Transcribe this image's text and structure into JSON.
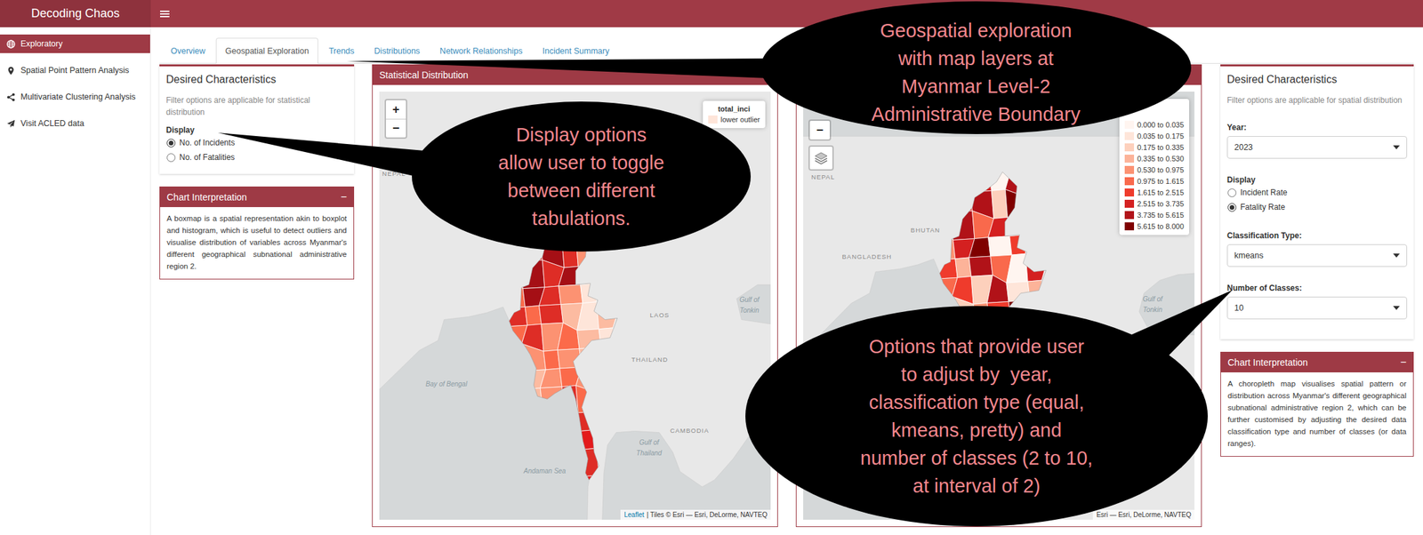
{
  "header": {
    "brand": "Decoding Chaos"
  },
  "sidebar": {
    "items": [
      {
        "label": "Exploratory",
        "selected": true
      },
      {
        "label": "Spatial Point Pattern Analysis",
        "selected": false
      },
      {
        "label": "Multivariate Clustering Analysis",
        "selected": false
      },
      {
        "label": "Visit ACLED data",
        "selected": false
      }
    ]
  },
  "tabs": [
    {
      "label": "Overview",
      "selected": false
    },
    {
      "label": "Geospatial Exploration",
      "selected": true
    },
    {
      "label": "Trends",
      "selected": false
    },
    {
      "label": "Distributions",
      "selected": false
    },
    {
      "label": "Network Relationships",
      "selected": false
    },
    {
      "label": "Incident Summary",
      "selected": false
    }
  ],
  "left_panel": {
    "title": "Desired Characteristics",
    "note": "Filter options are applicable for statistical distribution",
    "fields": [
      {
        "kind": "radio",
        "label": "Display",
        "options": [
          {
            "label": "No. of Incidents",
            "selected": true
          },
          {
            "label": "No. of Fatalities",
            "selected": false
          }
        ]
      }
    ]
  },
  "left_interpretation": {
    "title": "Chart Interpretation",
    "toggle": "−",
    "text": "A boxmap is a spatial representation akin to boxplot and histogram, which is useful to detect outliers and visualise distribution of variables across Myanmar's different geographical subnational administrative region 2."
  },
  "maps": [
    {
      "title": "Statistical Distribution",
      "zoom": [
        "+",
        "−"
      ],
      "layers": false,
      "legend": {
        "title": "total_inci",
        "items": [
          {
            "label": "lower outlier",
            "color": "#fee5d9"
          }
        ]
      },
      "labels": [
        {
          "text": "NEPAL",
          "kind": "country"
        },
        {
          "text": "LAOS",
          "kind": "country"
        },
        {
          "text": "Gulf of",
          "kind": "water"
        },
        {
          "text": "Tonkin",
          "kind": "water"
        },
        {
          "text": "THAILAND",
          "kind": "country"
        },
        {
          "text": "Bay of Bengal",
          "kind": "water"
        },
        {
          "text": "CAMBODIA",
          "kind": "country"
        },
        {
          "text": "Gulf of",
          "kind": "water"
        },
        {
          "text": "Thailand",
          "kind": "water"
        },
        {
          "text": "Andaman Sea",
          "kind": "water"
        }
      ],
      "attribution_link": "Leaflet",
      "attribution": "| Tiles © Esri — Esri, DeLorme, NAVTEQ",
      "regions": [
        [
          "#a50f15",
          "#de2d26",
          "#fb6a4a"
        ],
        [
          "#de2d26",
          "#a50f15",
          "#de2d26",
          "#fc9272"
        ],
        [
          "#a50f15",
          "#de2d26",
          "#a50f15",
          "#fcbba1"
        ],
        [
          "#fb6a4a",
          "#a50f15",
          "#de2d26",
          "#fc9272",
          "#fee5d9"
        ],
        [
          "#de2d26",
          "#fb6a4a",
          "#de2d26",
          "#fcbba1",
          "#fee5d9",
          "#fcbba1"
        ],
        [
          "#fb6a4a",
          "#de2d26",
          "#fc9272",
          "#fb6a4a",
          "#fcbba1",
          "#fee5d9"
        ],
        [
          "#fc9272",
          "#fb6a4a",
          "#fc9272",
          "#fcbba1"
        ],
        [
          "#fcbba1",
          "#fc9272",
          "#fb6a4a",
          "#fc9272"
        ],
        [
          "#fcbba1",
          "#fc9272",
          "#de2d26",
          "#fb6a4a"
        ],
        [
          "#de2d26"
        ],
        [
          "#e31a1c"
        ],
        [
          "#de2d26"
        ],
        [
          "#e31a1c"
        ]
      ]
    },
    {
      "zoom": [
        "−"
      ],
      "layers": true,
      "legend": {
        "items": [
          {
            "label": "0.000 to 0.035",
            "color": "#fff5f0"
          },
          {
            "label": "0.035 to 0.175",
            "color": "#fee5d9"
          },
          {
            "label": "0.175 to 0.335",
            "color": "#fdd0bc"
          },
          {
            "label": "0.335 to 0.530",
            "color": "#fcb399"
          },
          {
            "label": "0.530 to 0.975",
            "color": "#fc9272"
          },
          {
            "label": "0.975 to 1.615",
            "color": "#f9694c"
          },
          {
            "label": "1.615 to 2.515",
            "color": "#ef3b2c"
          },
          {
            "label": "2.515 to 3.735",
            "color": "#d42020"
          },
          {
            "label": "3.735 to 5.615",
            "color": "#b11218"
          },
          {
            "label": "5.615 to 8.000",
            "color": "#7f0000"
          }
        ]
      },
      "labels": [
        {
          "text": "NEPAL",
          "kind": "country"
        },
        {
          "text": "BHUTAN",
          "kind": "country"
        },
        {
          "text": "BANGLADESH",
          "kind": "country"
        },
        {
          "text": "Gulf of",
          "kind": "water"
        },
        {
          "text": "Tonkin",
          "kind": "water"
        }
      ],
      "attribution": "Esri — Esri, DeLorme, NAVTEQ",
      "regions": [
        [
          "#d42020",
          "#fff5f0",
          "#b11218"
        ],
        [
          "#ef3b2c",
          "#b11218",
          "#fdd0bc",
          "#7f0000"
        ],
        [
          "#b11218",
          "#f9694c",
          "#d42020",
          "#fee5d9"
        ],
        [
          "#fc9272",
          "#d42020",
          "#7f0000",
          "#fff5f0",
          "#ef3b2c"
        ],
        [
          "#ef3b2c",
          "#fcb399",
          "#b11218",
          "#f9694c",
          "#fff5f0",
          "#d42020"
        ],
        [
          "#f9694c",
          "#ef3b2c",
          "#fdd0bc",
          "#b11218",
          "#fee5d9",
          "#fcb399"
        ],
        [
          "#fdd0bc",
          "#fc9272",
          "#ef3b2c",
          "#7f0000"
        ],
        [
          "#fee5d9",
          "#fcb399",
          "#d42020",
          "#fc9272"
        ],
        [
          "#fff5f0",
          "#f9694c",
          "#b11218",
          "#ef3b2c"
        ],
        [
          "#d42020"
        ],
        [
          "#ef3b2c"
        ],
        [
          "#fc9272"
        ],
        [
          "#b11218"
        ]
      ]
    }
  ],
  "right_panel": {
    "title": "Desired Characteristics",
    "note": "Filter options are applicable for spatial distribution",
    "fields": [
      {
        "kind": "select",
        "label": "Year:",
        "value": "2023"
      },
      {
        "kind": "radio",
        "label": "Display",
        "options": [
          {
            "label": "Incident Rate",
            "selected": false
          },
          {
            "label": "Fatality Rate",
            "selected": true
          }
        ]
      },
      {
        "kind": "select",
        "label": "Classification Type:",
        "value": "kmeans"
      },
      {
        "kind": "select",
        "label": "Number of Classes:",
        "value": "10"
      }
    ]
  },
  "right_interpretation": {
    "title": "Chart Interpretation",
    "toggle": "−",
    "text": "A choropleth map visualises spatial pattern or distribution across Myanmar's different geographical subnational administrative region 2, which can be further customised by adjusting the desired data classification type and number of classes (or data ranges)."
  },
  "callouts": [
    {
      "lines": [
        "Geospatial exploration",
        "with map layers at",
        "Myanmar Level-2",
        "Administrative Boundary"
      ]
    },
    {
      "lines": [
        "Display options",
        "allow user to toggle",
        "between different",
        "tabulations."
      ]
    },
    {
      "lines": [
        "Options that provide user",
        "to adjust by  year,",
        "classification type (equal,",
        "kmeans, pretty) and",
        "number of classes (2 to 10,",
        "at interval of 2)"
      ]
    }
  ]
}
